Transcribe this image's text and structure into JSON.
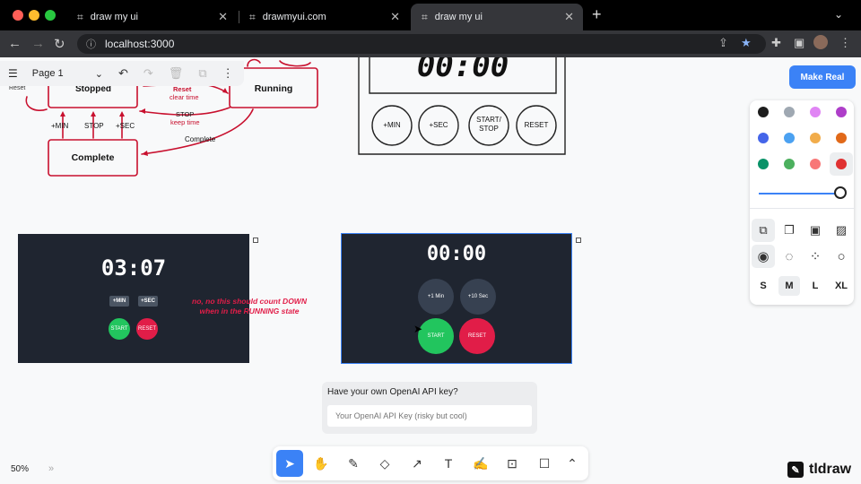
{
  "browser": {
    "tabs": [
      {
        "title": "draw my ui",
        "active": false
      },
      {
        "title": "drawmyui.com",
        "active": false
      },
      {
        "title": "draw my ui",
        "active": true
      }
    ],
    "new_tab_icon": "plus-icon",
    "url": "localhost:3000"
  },
  "page_menu": {
    "page_name": "Page 1"
  },
  "make_real": {
    "label": "Make Real",
    "color": "#3b82f6"
  },
  "diagram": {
    "state_stopped": "Stopped",
    "state_running": "Running",
    "state_complete": "Complete",
    "edge_reset": "Reset",
    "edge_reset_note": "clear time",
    "edge_stop": "STOP",
    "edge_stop_note": "keep time",
    "edge_complete": "Complete",
    "action_min": "+MIN",
    "action_stop": "STOP",
    "action_sec": "+SEC",
    "reset_left": "Reset",
    "accent": "#c8102e"
  },
  "sketch": {
    "display": "00:00",
    "buttons": [
      "+MIN",
      "+SEC",
      "START/\nSTOP",
      "RESET"
    ]
  },
  "timer_left": {
    "display": "03:07",
    "min_label": "+MIN",
    "sec_label": "+SEC",
    "start_label": "START",
    "reset_label": "RESET"
  },
  "note": {
    "line1": "no, no this should count DOWN",
    "line2": "when in the RUNNING state",
    "color": "#e11d48"
  },
  "timer_right": {
    "display": "00:00",
    "min_label": "+1 Min",
    "sec_label": "+10 Sec",
    "start_label": "START",
    "reset_label": "RESET"
  },
  "api_key": {
    "label": "Have your own OpenAI API key?",
    "placeholder": "Your OpenAI API Key (risky but cool)"
  },
  "style_panel": {
    "colors": [
      "#1d1d1d",
      "#9fa8b2",
      "#e085f4",
      "#ae3ec9",
      "#4465e9",
      "#4ba1f1",
      "#f1ac4b",
      "#e16919",
      "#099268",
      "#4cb05e",
      "#f87777",
      "#e03131"
    ],
    "selected_color": "#e03131",
    "sizes": [
      "S",
      "M",
      "L",
      "XL"
    ],
    "selected_size": "M"
  },
  "toolbar": {
    "tools": [
      "select-tool",
      "hand-tool",
      "draw-tool",
      "eraser-tool",
      "arrow-tool",
      "text-tool",
      "note-tool",
      "image-tool",
      "rectangle-tool",
      "more-tools"
    ],
    "active": "select-tool"
  },
  "zoom": {
    "level": "50%"
  },
  "brand": {
    "name": "tldraw"
  }
}
